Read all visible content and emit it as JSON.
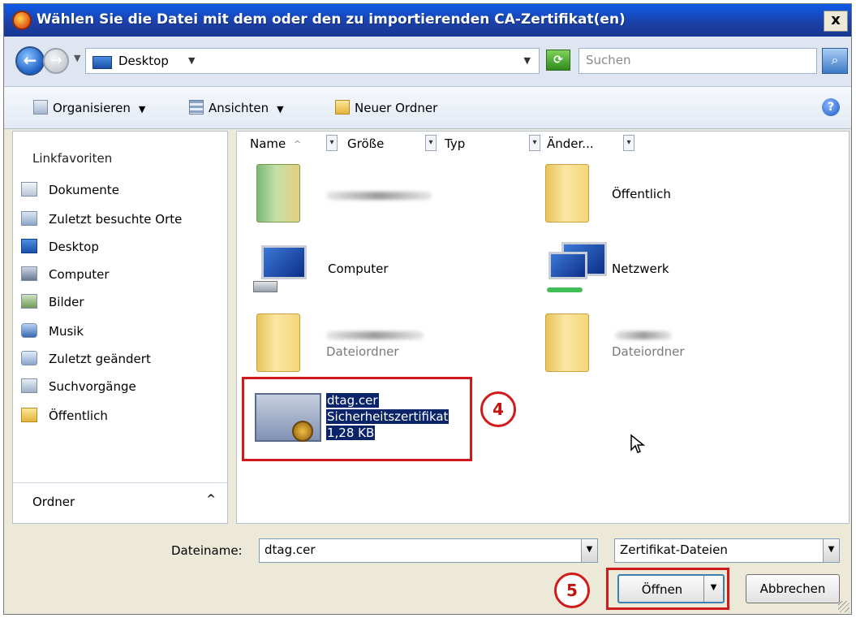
{
  "titlebar": {
    "title": "Wählen Sie die Datei mit dem oder den zu importierenden CA-Zertifikat(en)",
    "close_label": "x"
  },
  "address": {
    "location": "Desktop",
    "search_placeholder": "Suchen"
  },
  "toolbar": {
    "organize": "Organisieren",
    "views": "Ansichten",
    "new_folder": "Neuer Ordner"
  },
  "sidebar": {
    "heading": "Linkfavoriten",
    "items": [
      {
        "label": "Dokumente",
        "icon": "documents-icon"
      },
      {
        "label": "Zuletzt besuchte Orte",
        "icon": "recent-places-icon"
      },
      {
        "label": "Desktop",
        "icon": "desktop-icon"
      },
      {
        "label": "Computer",
        "icon": "computer-icon"
      },
      {
        "label": "Bilder",
        "icon": "pictures-icon"
      },
      {
        "label": "Musik",
        "icon": "music-icon"
      },
      {
        "label": "Zuletzt geändert",
        "icon": "recently-changed-icon"
      },
      {
        "label": "Suchvorgänge",
        "icon": "searches-icon"
      },
      {
        "label": "Öffentlich",
        "icon": "public-folder-icon"
      }
    ],
    "folders_label": "Ordner"
  },
  "columns": [
    "Name",
    "Größe",
    "Typ",
    "Änder..."
  ],
  "files": {
    "public": "Öffentlich",
    "computer": "Computer",
    "network": "Netzwerk",
    "folder_type_1": "Dateiordner",
    "folder_type_2": "Dateiordner",
    "cert_name": "dtag.cer",
    "cert_type": "Sicherheitszertifikat",
    "cert_size": "1,28 KB"
  },
  "annotations": {
    "step4": "4",
    "step5": "5",
    "color": "#d11b1b"
  },
  "bottom": {
    "filename_label": "Dateiname:",
    "filename_value": "dtag.cer",
    "filetype_value": "Zertifikat-Dateien",
    "open_button": "Öffnen",
    "cancel_button": "Abbrechen"
  }
}
